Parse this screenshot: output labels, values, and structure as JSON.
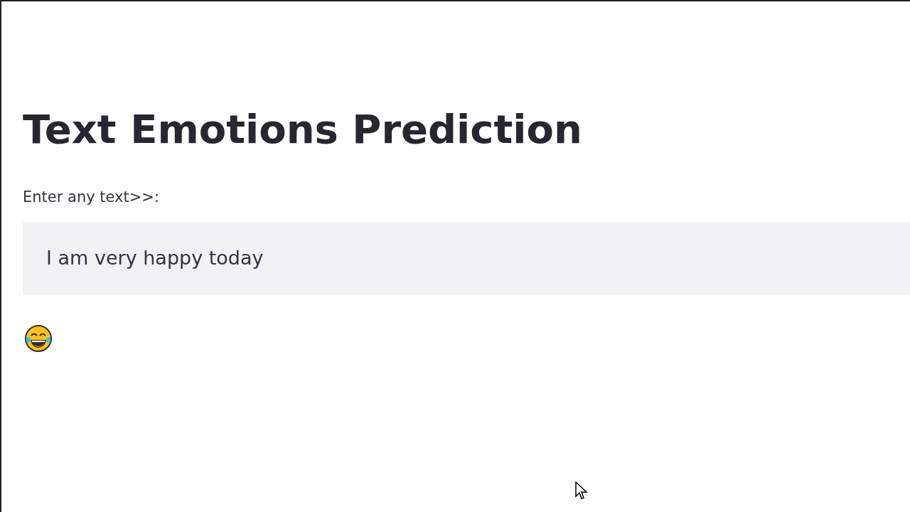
{
  "title": "Text Emotions Prediction",
  "input": {
    "label": "Enter any text>>:",
    "value": "I am very happy today"
  },
  "prediction": {
    "kind": "laughing"
  }
}
